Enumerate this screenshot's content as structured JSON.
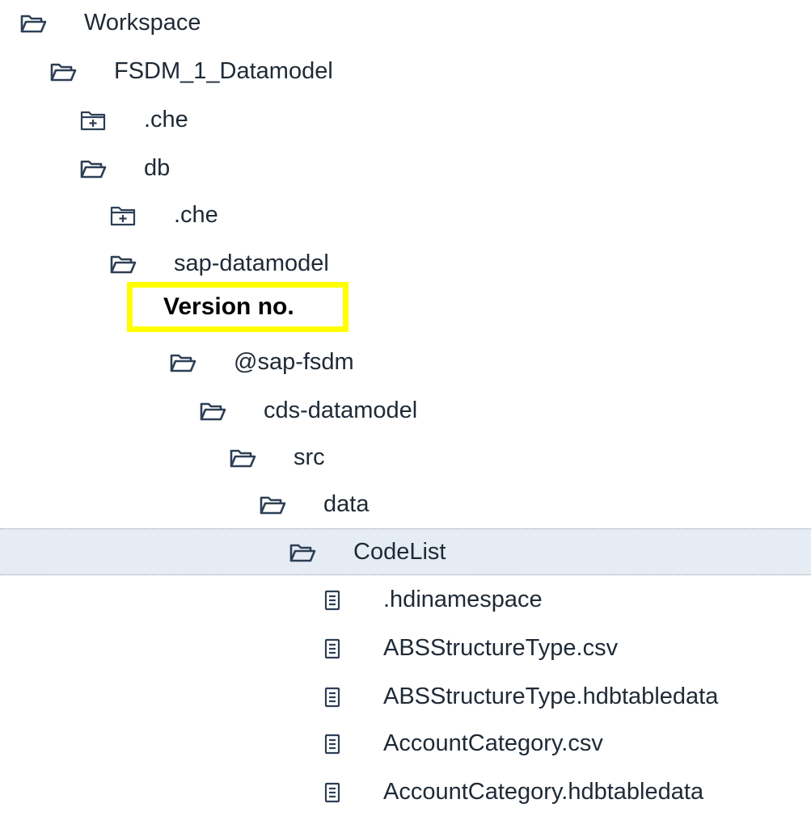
{
  "tree": {
    "items": [
      {
        "label": "Workspace",
        "icon": "open-folder-icon",
        "depth": 0,
        "selected": false
      },
      {
        "label": "FSDM_1_Datamodel",
        "icon": "open-folder-icon",
        "depth": 1,
        "selected": false
      },
      {
        "label": ".che",
        "icon": "collapsed-folder-icon",
        "depth": 2,
        "selected": false
      },
      {
        "label": "db",
        "icon": "open-folder-icon",
        "depth": 2,
        "selected": false
      },
      {
        "label": ".che",
        "icon": "collapsed-folder-icon",
        "depth": 3,
        "selected": false
      },
      {
        "label": "sap-datamodel",
        "icon": "open-folder-icon",
        "depth": 3,
        "selected": false
      },
      {
        "label": "@sap-fsdm",
        "icon": "open-folder-icon",
        "depth": 5,
        "selected": false
      },
      {
        "label": "cds-datamodel",
        "icon": "open-folder-icon",
        "depth": 6,
        "selected": false
      },
      {
        "label": "src",
        "icon": "open-folder-icon",
        "depth": 7,
        "selected": false
      },
      {
        "label": "data",
        "icon": "open-folder-icon",
        "depth": 8,
        "selected": false
      },
      {
        "label": "CodeList",
        "icon": "open-folder-icon",
        "depth": 9,
        "selected": true
      },
      {
        "label": ".hdinamespace",
        "icon": "file-icon",
        "depth": 10,
        "selected": false
      },
      {
        "label": "ABSStructureType.csv",
        "icon": "file-icon",
        "depth": 10,
        "selected": false
      },
      {
        "label": "ABSStructureType.hdbtabledata",
        "icon": "file-icon",
        "depth": 10,
        "selected": false
      },
      {
        "label": "AccountCategory.csv",
        "icon": "file-icon",
        "depth": 10,
        "selected": false
      },
      {
        "label": "AccountCategory.hdbtabledata",
        "icon": "file-icon",
        "depth": 10,
        "selected": false
      }
    ]
  },
  "annotation": {
    "text": "Version no.",
    "border_color": "#ffff00"
  },
  "colors": {
    "text": "#1f2a36",
    "icon": "#2d3f55",
    "selected_row": "#e6ecf3"
  }
}
